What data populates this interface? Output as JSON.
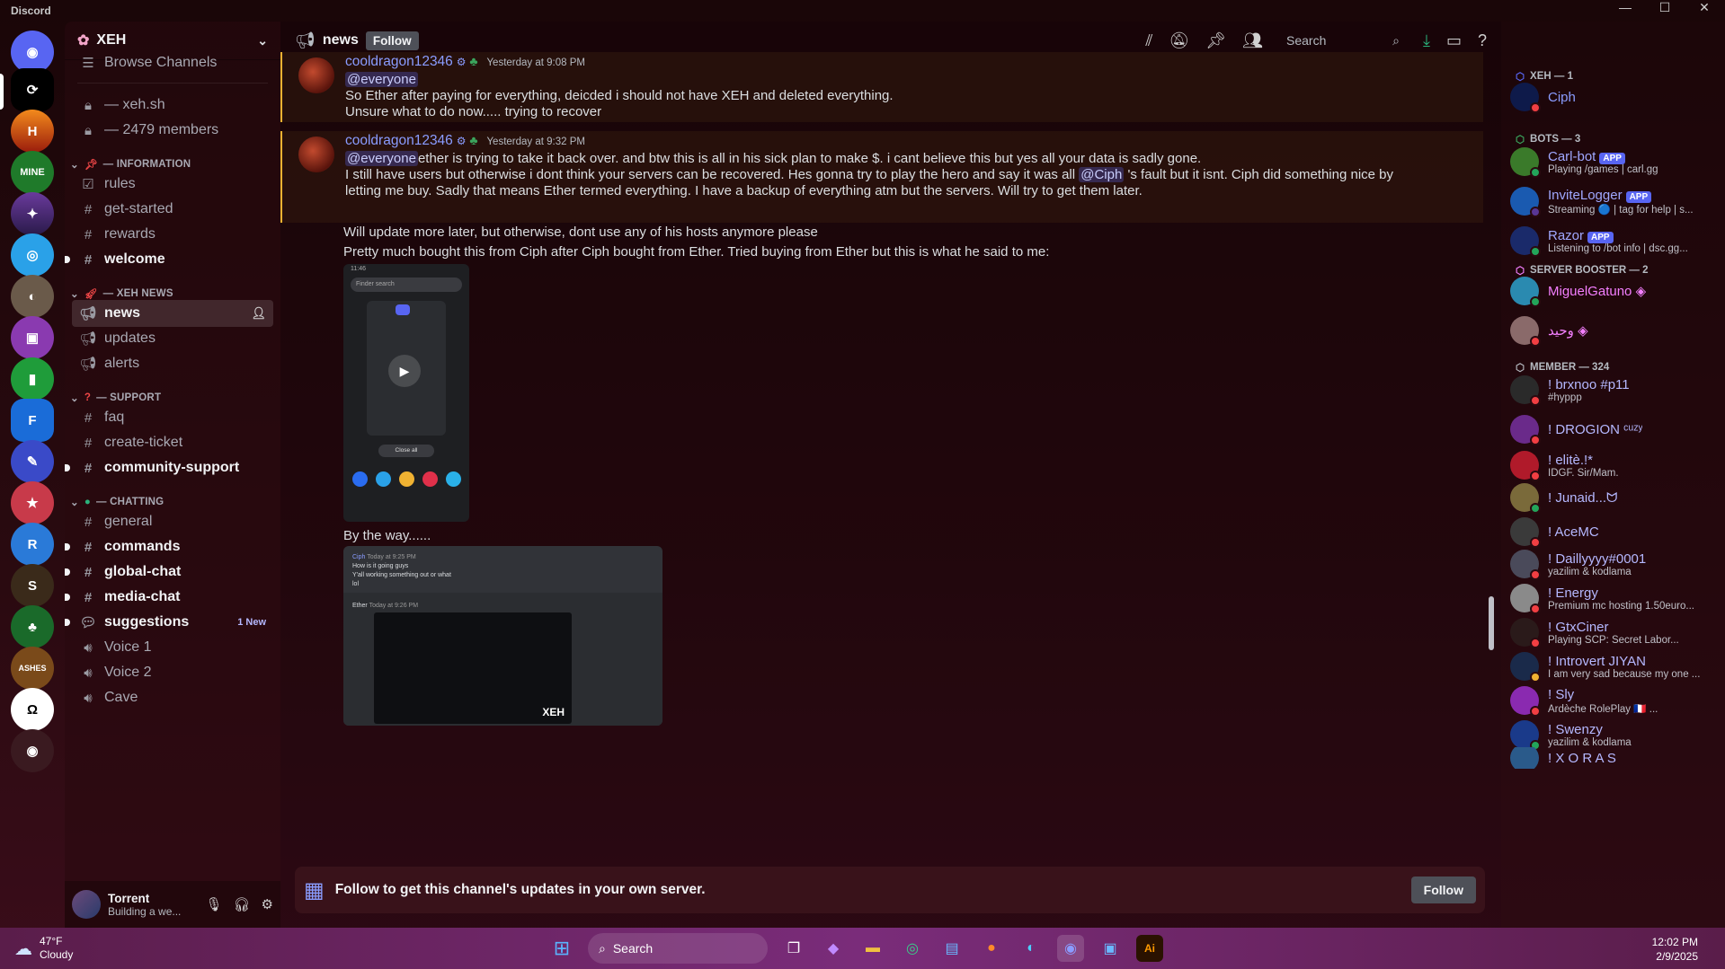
{
  "window": {
    "title": "Discord"
  },
  "server": {
    "name": "XEH"
  },
  "channels": {
    "browse": "Browse Channels",
    "locked": [
      {
        "label": "— xeh.sh"
      },
      {
        "label": "— 2479 members"
      }
    ],
    "categories": [
      {
        "label": "— INFORMATION"
      },
      {
        "label": "— XEH NEWS"
      },
      {
        "label": "— SUPPORT"
      },
      {
        "label": "— CHATTING"
      }
    ],
    "items": [
      {
        "label": "rules"
      },
      {
        "label": "get-started"
      },
      {
        "label": "rewards"
      },
      {
        "label": "welcome"
      },
      {
        "label": "news"
      },
      {
        "label": "updates"
      },
      {
        "label": "alerts"
      },
      {
        "label": "faq"
      },
      {
        "label": "create-ticket"
      },
      {
        "label": "community-support"
      },
      {
        "label": "general"
      },
      {
        "label": "commands"
      },
      {
        "label": "global-chat"
      },
      {
        "label": "media-chat"
      },
      {
        "label": "suggestions",
        "badge": "1 New"
      },
      {
        "label": "Voice 1"
      },
      {
        "label": "Voice 2"
      },
      {
        "label": "Cave"
      }
    ]
  },
  "user": {
    "name": "Torrent",
    "status": "Building a we..."
  },
  "header": {
    "channel": "news",
    "follow": "Follow",
    "search_placeholder": "Search"
  },
  "messages": [
    {
      "author": "cooldragon12346",
      "time": "Yesterday at 9:08 PM",
      "lines": [
        "@everyone",
        "So Ether after paying for everything, deicded i should not have XEH and deleted everything.",
        "Unsure what to do now..... trying to recover"
      ]
    },
    {
      "author": "cooldragon12346",
      "time": "Yesterday at 9:32 PM",
      "mention": "@everyone",
      "l1": "ether is trying to take it back over. and btw this is all in his sick plan to make $. i cant believe this but yes all your data is sadly gone.",
      "l2a": "I still have users but otherwise i dont think your servers can be recovered. Hes gonna try to play the hero and say it was all ",
      "l2m": "@Ciph",
      "l2b": " 's fault but it isnt. Ciph did something nice by",
      "l3": "letting me buy. Sadly that means Ether termed everything. I have a backup of everything atm but the servers. Will try to get them later.",
      "l4": "Will update more later, but otherwise, dont use any of his hosts anymore please",
      "l5": "Pretty much bought this from Ciph after Ciph bought from Ether. Tried buying from Ether but this is what he said to me:",
      "l6": "By the way......"
    }
  ],
  "embed1": {
    "time": "11:46",
    "search": "Finder search",
    "close_all": "Close all"
  },
  "embed2": {
    "ciph": "Ciph",
    "ciph_time": "Today at 9:25 PM",
    "ciph_msg1": "How is it going guys",
    "ciph_msg2": "Y'all working something out or what",
    "ciph_msg3": "lol",
    "ether": "Ether",
    "ether_time": "Today at 9:26 PM",
    "watermark": "XEH"
  },
  "followbar": {
    "text": "Follow to get this channel's updates in your own server.",
    "button": "Follow"
  },
  "members": {
    "groups": [
      {
        "label": "XEH — 1"
      },
      {
        "label": "BOTS — 3"
      },
      {
        "label": "SERVER BOOSTER — 2"
      },
      {
        "label": "MEMBER — 324"
      }
    ],
    "list": [
      {
        "name": "Ciph",
        "sub": ""
      },
      {
        "name": "Carl-bot",
        "sub": "Playing /games | carl.gg",
        "badge": "APP"
      },
      {
        "name": "InviteLogger",
        "sub": "Streaming 🔵 | tag for help | s...",
        "badge": "APP"
      },
      {
        "name": "Razor",
        "sub": "Listening to /bot info | dsc.gg...",
        "badge": "APP"
      },
      {
        "name": "MiguelGatuno",
        "sub": ""
      },
      {
        "name": "وحيد",
        "sub": ""
      },
      {
        "name": "! brxnoo #p11",
        "sub": "#hyppp"
      },
      {
        "name": "! DROGION ᶜᵘᶻʸ",
        "sub": ""
      },
      {
        "name": "! elitè.!*",
        "sub": "IDGF. Sir/Mam."
      },
      {
        "name": "! Junaid...ᗢ",
        "sub": ""
      },
      {
        "name": "! AceMC",
        "sub": ""
      },
      {
        "name": "! Daillyyyy#0001",
        "sub": "yazilim & kodlama"
      },
      {
        "name": "! Energy",
        "sub": "Premium mc hosting 1.50euro..."
      },
      {
        "name": "! GtxCiner",
        "sub": "Playing SCP: Secret Labor..."
      },
      {
        "name": "! Introvert JIYAN",
        "sub": "I am very sad because my one ..."
      },
      {
        "name": "! Sly",
        "sub": "Ardèche RolePlay 🇫🇷 ..."
      },
      {
        "name": "! Swenzy",
        "sub": "yazilim & kodlama"
      },
      {
        "name": "! X O R A S",
        "sub": ""
      }
    ]
  },
  "taskbar": {
    "temp": "47°F",
    "weather": "Cloudy",
    "search": "Search",
    "time": "12:02 PM",
    "date": "2/9/2025"
  },
  "colors": {
    "accent": "#5865f2",
    "follow": "#4e5058",
    "booster": "#f47fff"
  }
}
